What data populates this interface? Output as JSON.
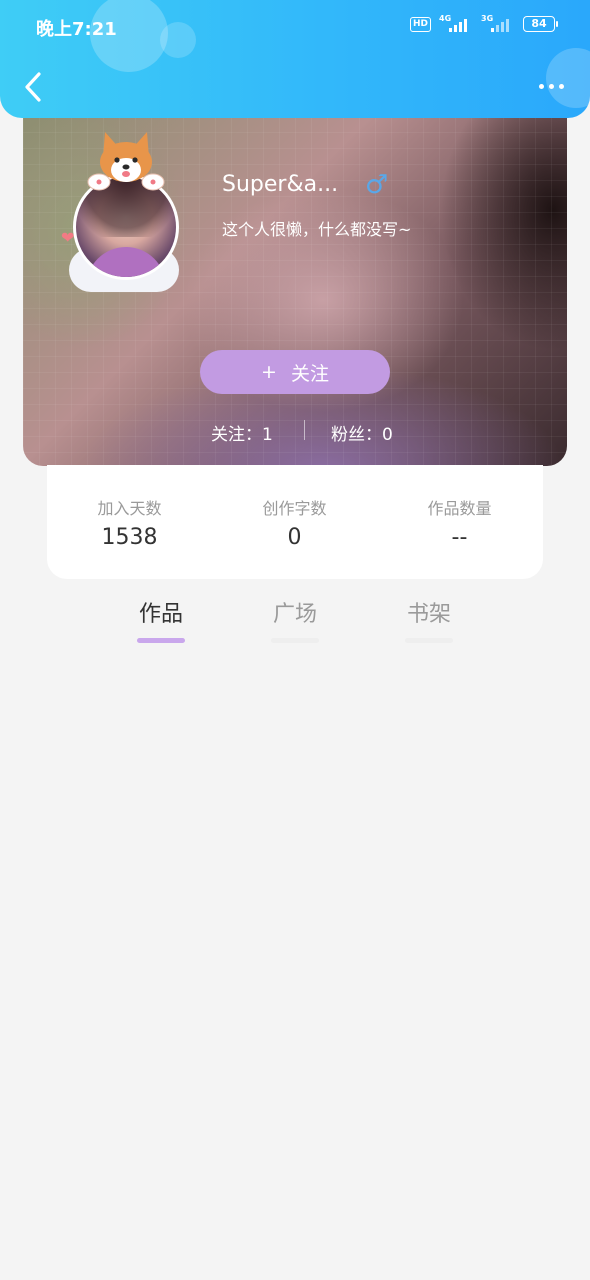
{
  "status_bar": {
    "time": "晚上7:21",
    "hd": "HD",
    "net1": "4G",
    "net2": "3G",
    "battery": "84"
  },
  "nav": {
    "back_icon": "chevron-left-icon",
    "more_icon": "more-dots-icon"
  },
  "profile": {
    "nickname": "Super&a...",
    "gender_symbol": "♂",
    "bio": "这个人很懒，什么都没写~",
    "follow_plus": "+",
    "follow_label": "关注",
    "following_text": "关注：1",
    "fans_text": "粉丝：0"
  },
  "stats": [
    {
      "label": "加入天数",
      "value": "1538"
    },
    {
      "label": "创作字数",
      "value": "0"
    },
    {
      "label": "作品数量",
      "value": "--"
    }
  ],
  "tabs": [
    {
      "label": "作品",
      "active": true
    },
    {
      "label": "广场",
      "active": false
    },
    {
      "label": "书架",
      "active": false
    }
  ],
  "colors": {
    "header_start": "#3fcdf6",
    "header_end": "#2aa8fb",
    "accent_purple": "#c29be2",
    "tab_indicator": "#c9a7ec",
    "gender_blue": "#5aa7e8"
  }
}
